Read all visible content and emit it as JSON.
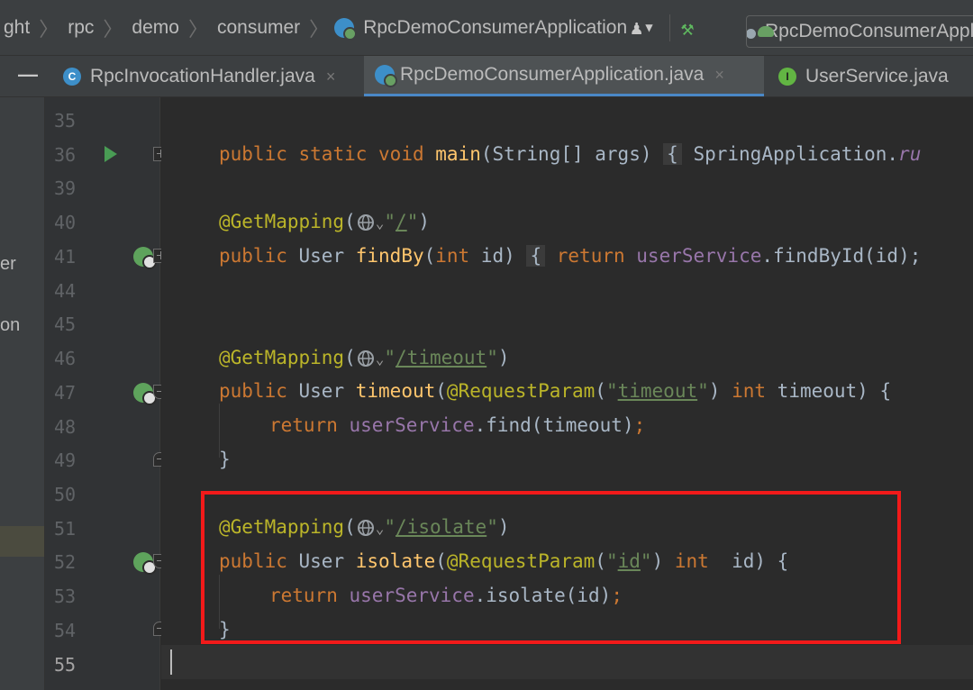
{
  "navbar": {
    "breadcrumbs": [
      "ght",
      "rpc",
      "demo",
      "consumer",
      "RpcDemoConsumerApplication"
    ],
    "run_config": "RpcDemoConsumerApplication"
  },
  "tabs": [
    {
      "label": "RpcInvocationHandler.java",
      "icon": "class-icon",
      "active": false
    },
    {
      "label": "RpcDemoConsumerApplication.java",
      "icon": "spring-app-icon",
      "active": true
    },
    {
      "label": "UserService.java",
      "icon": "interface-icon",
      "active": false
    }
  ],
  "project_strip": {
    "items": [
      "er",
      "on"
    ]
  },
  "gutter": {
    "line_numbers": [
      "35",
      "36",
      "39",
      "40",
      "41",
      "44",
      "45",
      "46",
      "47",
      "48",
      "49",
      "50",
      "51",
      "52",
      "53",
      "54",
      "55"
    ]
  },
  "code": {
    "l36_public": "public",
    "l36_static": "static",
    "l36_void": "void",
    "l36_name": "main",
    "l36_sig": "(String[] args)",
    "l36_fold": "{",
    "l36_body": "SpringApplication.",
    "l36_run": "ru",
    "l40_ann": "@GetMapping",
    "l40_path": "/",
    "l41_public": "public",
    "l41_type": "User",
    "l41_name": "findBy",
    "l41_int": "int",
    "l41_param": "id)",
    "l41_fold": "{",
    "l41_return": "return",
    "l41_field": "userService",
    "l41_call": ".findById(id);",
    "l46_ann": "@GetMapping",
    "l46_path": "/timeout",
    "l47_public": "public",
    "l47_type": "User",
    "l47_name": "timeout",
    "l47_ann": "@RequestParam",
    "l47_str": "timeout",
    "l47_int": "int",
    "l47_rest": "timeout) {",
    "l48_return": "return",
    "l48_field": "userService",
    "l48_call": ".find(timeout)",
    "l48_semi": ";",
    "l49_brace": "}",
    "l51_ann": "@GetMapping",
    "l51_path": "/isolate",
    "l52_public": "public",
    "l52_type": "User",
    "l52_name": "isolate",
    "l52_ann": "@RequestParam",
    "l52_str": "id",
    "l52_int": "int",
    "l52_rest": "id) {",
    "l53_return": "return",
    "l53_field": "userService",
    "l53_call": ".isolate(id)",
    "l53_semi": ";",
    "l54_brace": "}"
  },
  "colors": {
    "keyword": "#cc7832",
    "annotation": "#bbb529",
    "method": "#ffc66d",
    "string": "#6a8759",
    "field": "#9876aa",
    "highlight_box": "#f21a1a"
  }
}
